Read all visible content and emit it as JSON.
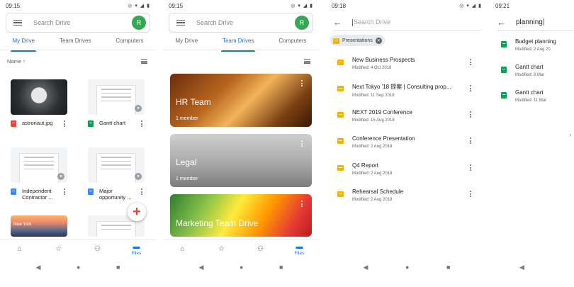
{
  "screen1": {
    "time": "09:15",
    "status_icons": "◎ ▾ ◢ ▮",
    "search_placeholder": "Search Drive",
    "avatar": "R",
    "tabs": [
      "My Drive",
      "Team Drives",
      "Computers"
    ],
    "sort_label": "Name ↑",
    "files": [
      {
        "name": "astronaut.jpg",
        "type": "image"
      },
      {
        "name": "Gantt chart",
        "type": "sheet"
      },
      {
        "name": "Independent Contractor ...",
        "type": "doc"
      },
      {
        "name": "Major opportunity ...",
        "type": "doc"
      }
    ],
    "city_caption": "New York",
    "fab": "+",
    "nav_files": "Files"
  },
  "screen2": {
    "time": "09:15",
    "status_icons": "◎ ▾ ◢ ▮",
    "search_placeholder": "Search Drive",
    "avatar": "R",
    "tabs": [
      "My Drive",
      "Team Drives",
      "Computers"
    ],
    "team_drives": [
      {
        "name": "HR Team",
        "members": "1 member"
      },
      {
        "name": "Legal",
        "members": "1 member"
      },
      {
        "name": "Marketing Team Drive",
        "members": ""
      }
    ],
    "nav_files": "Files"
  },
  "screen3": {
    "time": "09:18",
    "status_icons": "◎ ▾ ◢ ▮",
    "search_placeholder": "Search Drive",
    "chip": "Presentations",
    "results": [
      {
        "name": "New Business Prospects",
        "modified": "Modified: 4 Oct 2018"
      },
      {
        "name": "Next Tokyo '18 提案 | Consulting prop...",
        "modified": "Modified: 11 Sep 2018"
      },
      {
        "name": "NEXT 2019 Conference",
        "modified": "Modified: 15 Aug 2018"
      },
      {
        "name": "Conference Presentation",
        "modified": "Modified: 2 Aug 2018"
      },
      {
        "name": "Q4 Report",
        "modified": "Modified: 2 Aug 2018"
      },
      {
        "name": "Rehearsal Schedule",
        "modified": "Modified: 2 Aug 2018"
      }
    ]
  },
  "screen4": {
    "time": "09:21",
    "query": "planning",
    "results": [
      {
        "name": "Budget planning",
        "modified": "Modified: 2 Aug 20"
      },
      {
        "name": "Gantt chart",
        "modified": "Modified: 6 Mar"
      },
      {
        "name": "Gantt chart",
        "modified": "Modified: 11 Mar"
      }
    ]
  },
  "colors": {
    "accent": "#1a73e8",
    "avatar": "#34a853",
    "slides": "#f4b400",
    "sheets": "#0f9d58",
    "docs": "#4285f4"
  }
}
